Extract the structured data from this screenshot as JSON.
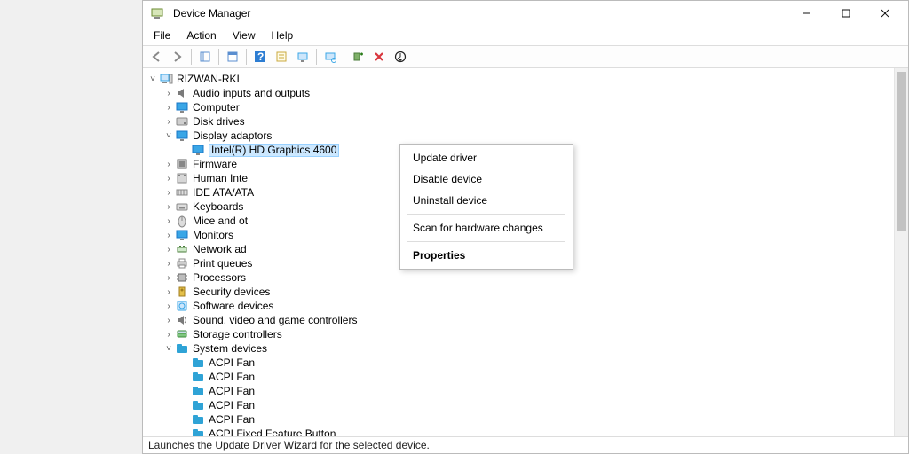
{
  "window": {
    "title": "Device Manager"
  },
  "menubar": [
    "File",
    "Action",
    "View",
    "Help"
  ],
  "statusbar": "Launches the Update Driver Wizard for the selected device.",
  "root": "RIZWAN-RKI",
  "tree": [
    {
      "label": "Audio inputs and outputs",
      "icon": "audio-icon",
      "expanded": false
    },
    {
      "label": "Computer",
      "icon": "computer-icon",
      "expanded": false
    },
    {
      "label": "Disk drives",
      "icon": "disk-icon",
      "expanded": false
    },
    {
      "label": "Display adaptors",
      "icon": "display-icon",
      "expanded": true,
      "children": [
        {
          "label": "Intel(R) HD Graphics 4600",
          "icon": "display-icon",
          "selected": true
        }
      ]
    },
    {
      "label": "Firmware",
      "icon": "firmware-icon",
      "expanded": false
    },
    {
      "label": "Human Interface Devices",
      "icon": "hid-icon",
      "expanded": false,
      "clip": "Human Inte"
    },
    {
      "label": "IDE ATA/ATAPI controllers",
      "icon": "ide-icon",
      "expanded": false,
      "clip": "IDE ATA/ATA"
    },
    {
      "label": "Keyboards",
      "icon": "keyboard-icon",
      "expanded": false
    },
    {
      "label": "Mice and other pointing devices",
      "icon": "mouse-icon",
      "expanded": false,
      "clip": "Mice and ot"
    },
    {
      "label": "Monitors",
      "icon": "monitor-icon",
      "expanded": false
    },
    {
      "label": "Network adapters",
      "icon": "network-icon",
      "expanded": false,
      "clip": "Network ad"
    },
    {
      "label": "Print queues",
      "icon": "printer-icon",
      "expanded": false
    },
    {
      "label": "Processors",
      "icon": "cpu-icon",
      "expanded": false
    },
    {
      "label": "Security devices",
      "icon": "security-icon",
      "expanded": false
    },
    {
      "label": "Software devices",
      "icon": "software-icon",
      "expanded": false
    },
    {
      "label": "Sound, video and game controllers",
      "icon": "sound-icon",
      "expanded": false
    },
    {
      "label": "Storage controllers",
      "icon": "storage-icon",
      "expanded": false
    },
    {
      "label": "System devices",
      "icon": "system-icon",
      "expanded": true,
      "children": [
        {
          "label": "ACPI Fan",
          "icon": "folder-icon"
        },
        {
          "label": "ACPI Fan",
          "icon": "folder-icon"
        },
        {
          "label": "ACPI Fan",
          "icon": "folder-icon"
        },
        {
          "label": "ACPI Fan",
          "icon": "folder-icon"
        },
        {
          "label": "ACPI Fan",
          "icon": "folder-icon"
        },
        {
          "label": "ACPI Fixed Feature Button",
          "icon": "folder-icon"
        }
      ]
    }
  ],
  "context": {
    "items": [
      {
        "label": "Update driver",
        "bold": false
      },
      {
        "label": "Disable device",
        "bold": false
      },
      {
        "label": "Uninstall device",
        "bold": false
      },
      {
        "sep": true
      },
      {
        "label": "Scan for hardware changes",
        "bold": false
      },
      {
        "sep": true
      },
      {
        "label": "Properties",
        "bold": true
      }
    ]
  },
  "toolbar_icons": [
    "back-icon",
    "forward-icon",
    "sep",
    "up-icon",
    "sep",
    "home-icon",
    "sep",
    "help-icon",
    "properties-icon",
    "refresh-icon",
    "sep",
    "scan-icon",
    "sep",
    "add-legacy-icon",
    "remove-icon",
    "update-icon"
  ]
}
